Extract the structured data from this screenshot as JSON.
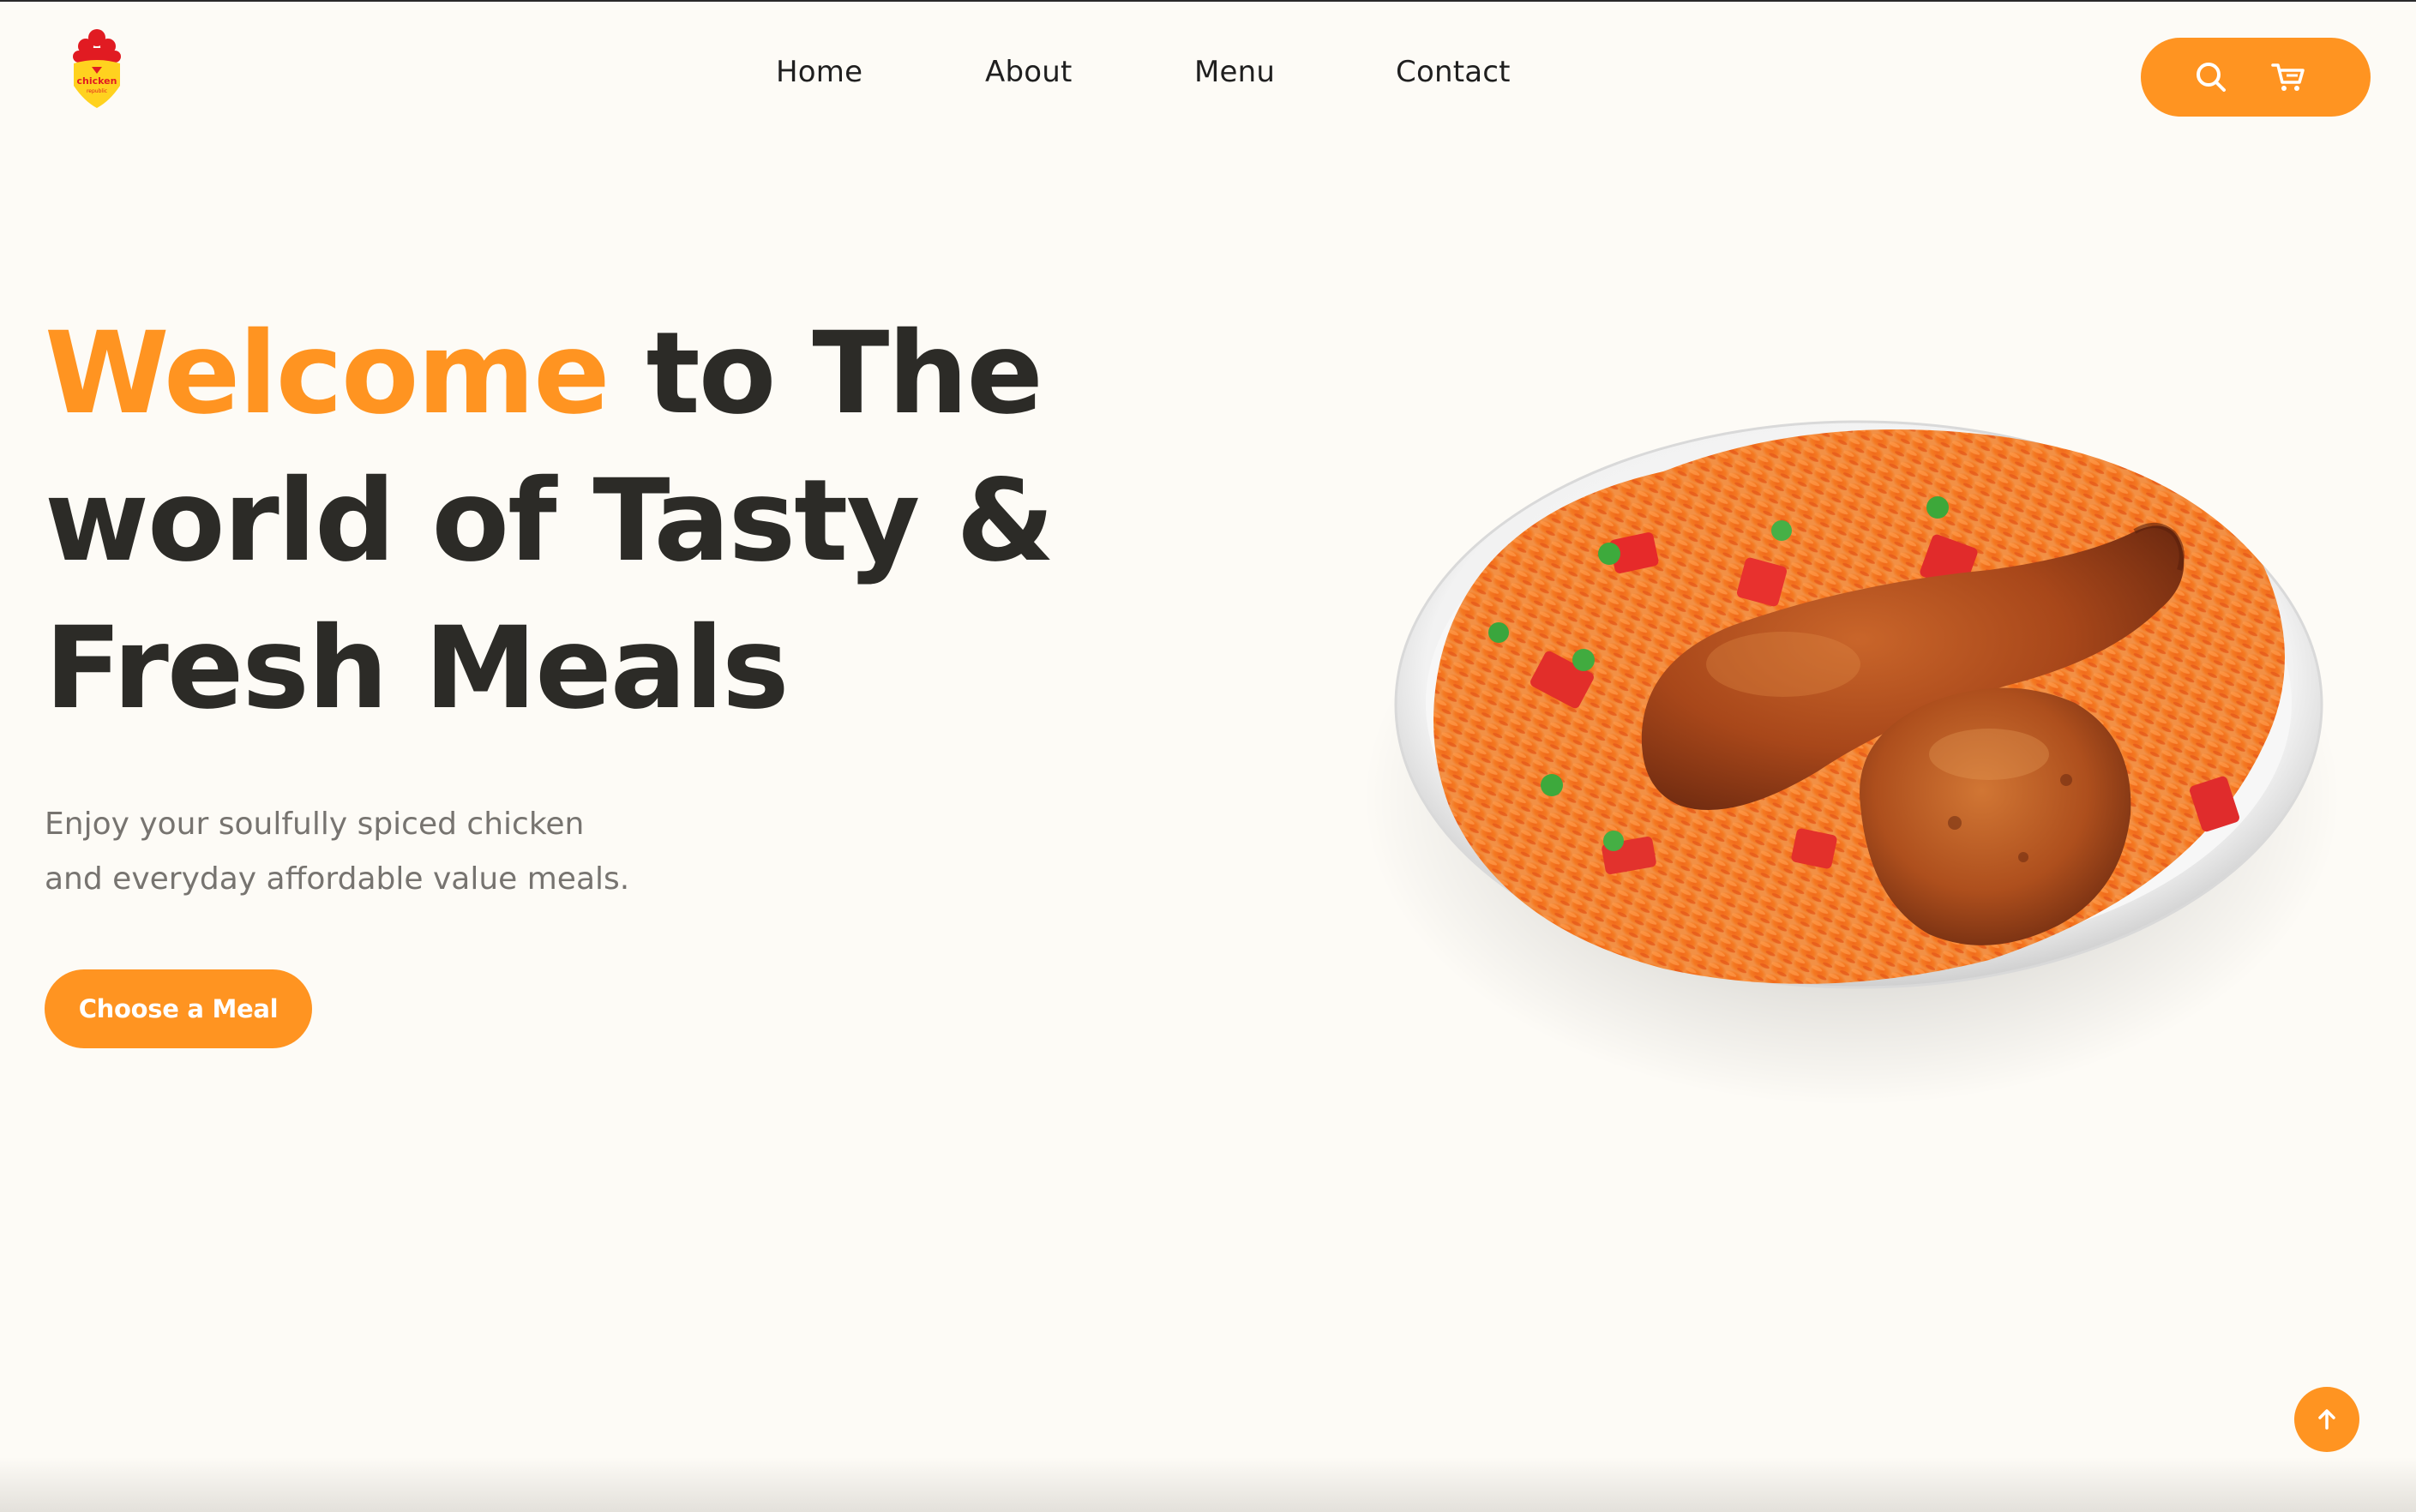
{
  "brand": {
    "logo_text": "chicken",
    "logo_subtext": "republic",
    "colors": {
      "accent": "#FF9421",
      "text_dark": "#2c2b27",
      "background": "#FDFBF6",
      "logo_red": "#E11B22",
      "logo_yellow": "#FFD21F"
    }
  },
  "nav": {
    "items": [
      {
        "label": "Home"
      },
      {
        "label": "About"
      },
      {
        "label": "Menu"
      },
      {
        "label": "Contact"
      }
    ]
  },
  "actions": {
    "search_icon": "search-icon",
    "cart_icon": "cart-icon"
  },
  "hero": {
    "title_accent": "Welcome",
    "title_line1_rest": " to The",
    "title_line2": "world of Tasty &",
    "title_line3": "Fresh Meals",
    "subtitle_line1": "Enjoy your soulfully spiced chicken",
    "subtitle_line2": "and everyday affordable value meals.",
    "cta_label": "Choose a Meal",
    "image": "jollof-rice-with-chicken-plate"
  },
  "scroll_top": {
    "icon": "arrow-up-icon"
  }
}
